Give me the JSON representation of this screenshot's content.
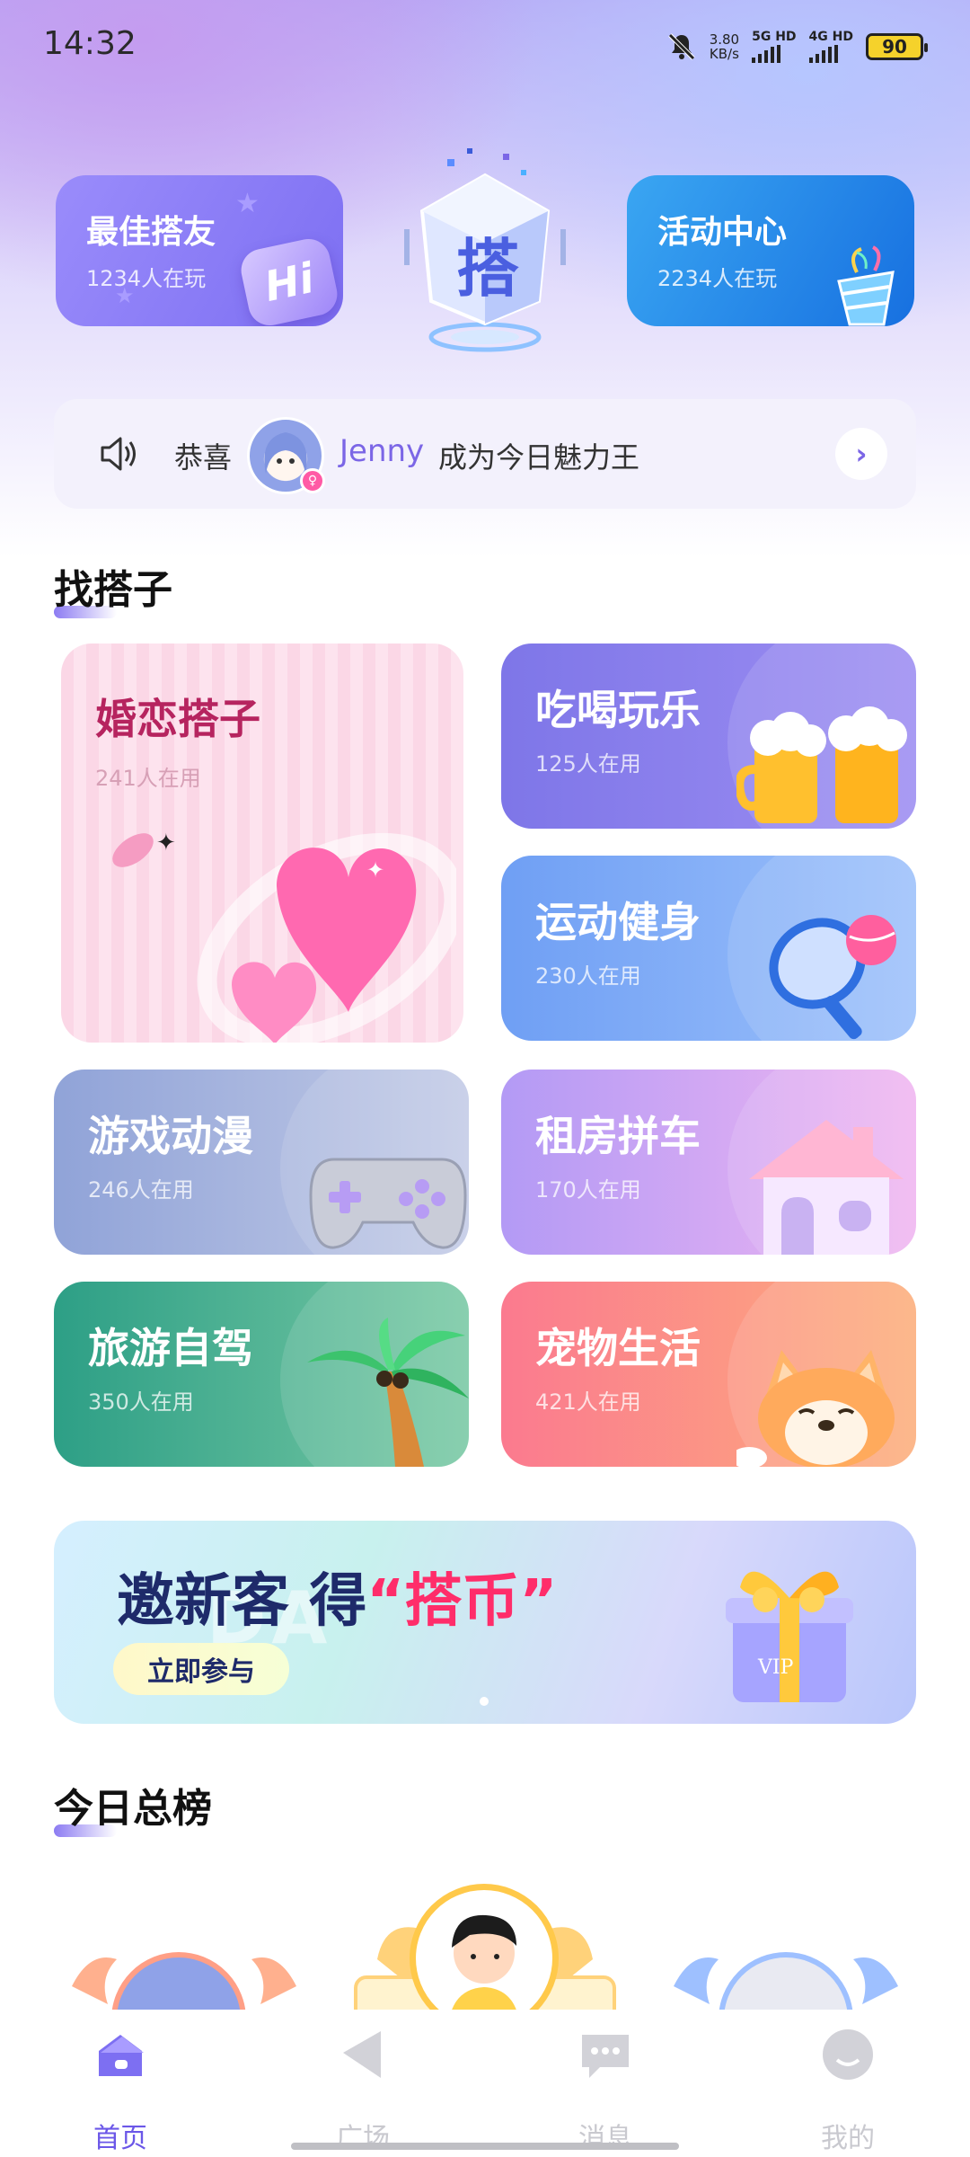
{
  "status_bar": {
    "time": "14:32",
    "speed_value": "3.80",
    "speed_unit": "KB/s",
    "net1": "5G HD",
    "net2": "4G HD",
    "battery": "90"
  },
  "top_cards": {
    "left": {
      "title": "最佳搭友",
      "subtitle": "1234人在玩",
      "badge": "Hi"
    },
    "center_logo": "搭",
    "right": {
      "title": "活动中心",
      "subtitle": "2234人在玩"
    }
  },
  "notice": {
    "label": "恭喜",
    "name": "Jenny",
    "text": "成为今日魅力王",
    "arrow": "›"
  },
  "find_section": {
    "title": "找搭子"
  },
  "categories": [
    {
      "title": "婚恋搭子",
      "count": "241人在用"
    },
    {
      "title": "吃喝玩乐",
      "count": "125人在用"
    },
    {
      "title": "运动健身",
      "count": "230人在用"
    },
    {
      "title": "游戏动漫",
      "count": "246人在用"
    },
    {
      "title": "租房拼车",
      "count": "170人在用"
    },
    {
      "title": "旅游自驾",
      "count": "350人在用"
    },
    {
      "title": "宠物生活",
      "count": "421人在用"
    }
  ],
  "banner": {
    "title_prefix": "邀新客 得",
    "title_highlight": "“搭币”",
    "button": "立即参与",
    "gift_label": "VIP"
  },
  "ranking_section": {
    "title": "今日总榜"
  },
  "tabs": [
    {
      "label": "首页",
      "icon": "home-icon",
      "active": true
    },
    {
      "label": "广场",
      "icon": "plaza-icon",
      "active": false
    },
    {
      "label": "消息",
      "icon": "message-icon",
      "active": false
    },
    {
      "label": "我的",
      "icon": "profile-icon",
      "active": false
    }
  ],
  "colors": {
    "accent": "#6b57e8",
    "highlight": "#ff2d6a"
  }
}
